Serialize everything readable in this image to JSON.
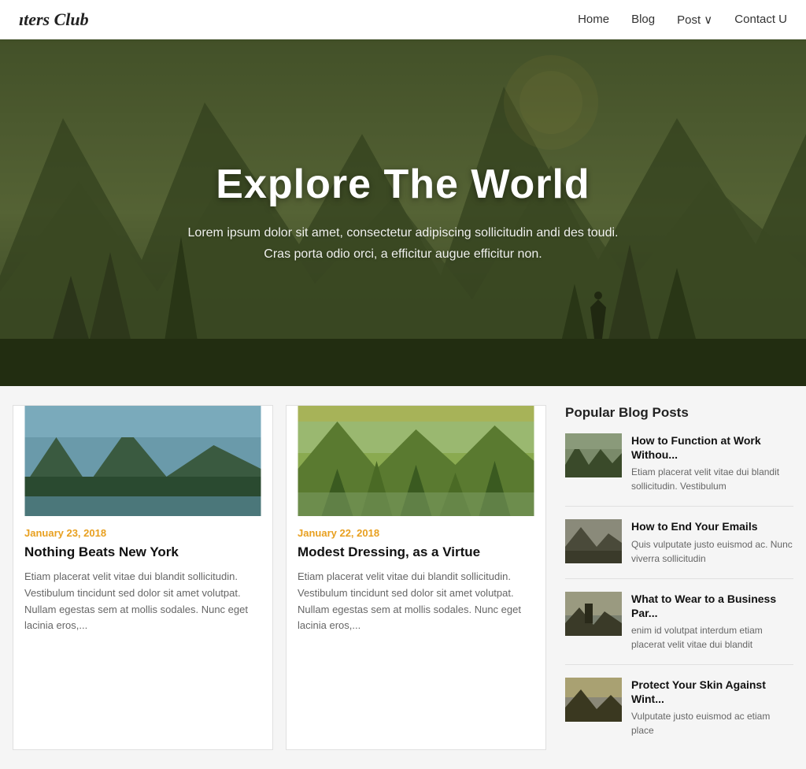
{
  "nav": {
    "logo": "iters Club",
    "links": [
      {
        "label": "Home",
        "id": "home"
      },
      {
        "label": "Blog",
        "id": "blog"
      },
      {
        "label": "Post ∨",
        "id": "post"
      },
      {
        "label": "Contact U",
        "id": "contact"
      }
    ]
  },
  "hero": {
    "title": "Explore The World",
    "subtitle_line1": "Lorem ipsum dolor sit amet, consectetur adipiscing sollicitudin andi des toudi.",
    "subtitle_line2": "Cras porta odio orci, a efficitur augue efficitur non."
  },
  "blog_posts": [
    {
      "date": "January 23, 2018",
      "title": "Nothing Beats New York",
      "excerpt": "Etiam placerat velit vitae dui blandit sollicitudin. Vestibulum tincidunt sed dolor sit amet volutpat. Nullam egestas sem at mollis sodales. Nunc eget lacinia eros,...",
      "img_colors": [
        "#7aadbe",
        "#4a7a8a",
        "#2a5a6a",
        "#5a8a6a",
        "#3a6a4a"
      ]
    },
    {
      "date": "January 22, 2018",
      "title": "Modest Dressing, as a Virtue",
      "excerpt": "Etiam placerat velit vitae dui blandit sollicitudin. Vestibulum tincidunt sed dolor sit amet volutpat. Nullam egestas sem at mollis sodales. Nunc eget lacinia eros,...",
      "img_colors": [
        "#c8a840",
        "#8aaa50",
        "#5a8a40",
        "#7aaa60",
        "#4a6a30"
      ]
    }
  ],
  "sidebar": {
    "title": "Popular Blog Posts",
    "posts": [
      {
        "title": "How to Function at Work Withou...",
        "excerpt": "Etiam placerat velit vitae dui blandit sollicitudin. Vestibulum",
        "img_colors": [
          "#888",
          "#666",
          "#555"
        ]
      },
      {
        "title": "How to End Your Emails",
        "excerpt": "Quis vulputate justo euismod ac. Nunc viverra sollicitudin",
        "img_colors": [
          "#777",
          "#999",
          "#555"
        ]
      },
      {
        "title": "What to Wear to a Business Par...",
        "excerpt": "enim id volutpat interdum etiam placerat velit vitae dui blandit",
        "img_colors": [
          "#888",
          "#666",
          "#444"
        ]
      },
      {
        "title": "Protect Your Skin Against Wint...",
        "excerpt": "Vulputate justo euismod ac etiam place",
        "img_colors": [
          "#777",
          "#888",
          "#555"
        ]
      }
    ]
  }
}
